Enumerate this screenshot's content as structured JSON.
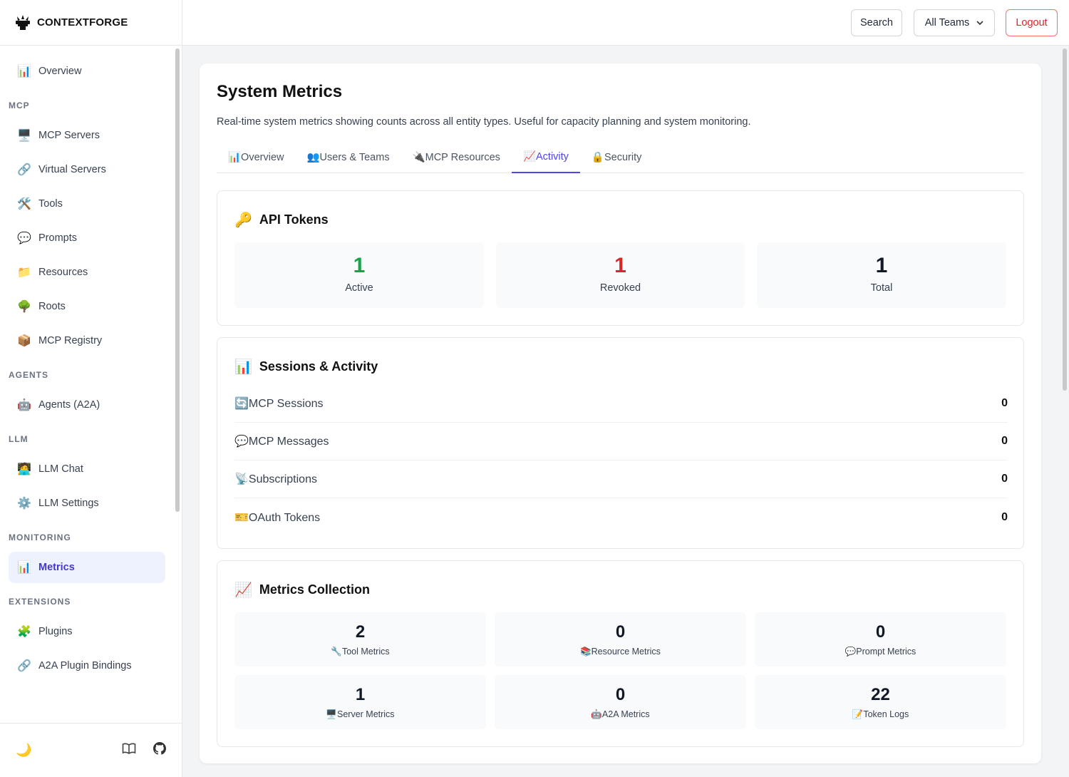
{
  "brand": {
    "name": "CONTEXTFORGE"
  },
  "sidebar": {
    "overview": {
      "label": "Overview",
      "icon": "📊"
    },
    "sections": [
      {
        "title": "MCP",
        "items": [
          {
            "label": "MCP Servers",
            "icon": "🖥️"
          },
          {
            "label": "Virtual Servers",
            "icon": "🔗"
          },
          {
            "label": "Tools",
            "icon": "🛠️"
          },
          {
            "label": "Prompts",
            "icon": "💬"
          },
          {
            "label": "Resources",
            "icon": "📁"
          },
          {
            "label": "Roots",
            "icon": "🌳"
          },
          {
            "label": "MCP Registry",
            "icon": "📦"
          }
        ]
      },
      {
        "title": "AGENTS",
        "items": [
          {
            "label": "Agents (A2A)",
            "icon": "🤖"
          }
        ]
      },
      {
        "title": "LLM",
        "items": [
          {
            "label": "LLM Chat",
            "icon": "🧑‍💻"
          },
          {
            "label": "LLM Settings",
            "icon": "⚙️"
          }
        ]
      },
      {
        "title": "MONITORING",
        "items": [
          {
            "label": "Metrics",
            "icon": "📊",
            "active": true
          }
        ]
      },
      {
        "title": "EXTENSIONS",
        "items": [
          {
            "label": "Plugins",
            "icon": "🧩"
          },
          {
            "label": "A2A Plugin Bindings",
            "icon": "🔗"
          }
        ]
      }
    ],
    "footer": {
      "theme_icon": "🌙"
    }
  },
  "topbar": {
    "search_label": "Search",
    "teams_label": "All Teams",
    "logout_label": "Logout"
  },
  "main": {
    "title": "System Metrics",
    "subtitle": "Real-time system metrics showing counts across all entity types. Useful for capacity planning and system monitoring.",
    "tabs": [
      {
        "label": "📊Overview"
      },
      {
        "label": "👥Users & Teams"
      },
      {
        "label": "🔌MCP Resources"
      },
      {
        "label": "📈Activity",
        "active": true
      },
      {
        "label": "🔒Security"
      }
    ],
    "api_tokens": {
      "title": "API Tokens",
      "icon": "🔑",
      "stats": [
        {
          "value": "1",
          "label": "Active",
          "color": "#16a34a"
        },
        {
          "value": "1",
          "label": "Revoked",
          "color": "#dc2626"
        },
        {
          "value": "1",
          "label": "Total",
          "color": "#111827"
        }
      ]
    },
    "sessions": {
      "title": "Sessions & Activity",
      "icon": "📊",
      "rows": [
        {
          "label": "🔄MCP Sessions",
          "value": "0"
        },
        {
          "label": "💬MCP Messages",
          "value": "0"
        },
        {
          "label": "📡Subscriptions",
          "value": "0"
        },
        {
          "label": "🎫OAuth Tokens",
          "value": "0"
        }
      ]
    },
    "metrics_collection": {
      "title": "Metrics Collection",
      "icon": "📈",
      "stats": [
        {
          "value": "2",
          "label": "🔧Tool Metrics"
        },
        {
          "value": "0",
          "label": "📚Resource Metrics"
        },
        {
          "value": "0",
          "label": "💬Prompt Metrics"
        },
        {
          "value": "1",
          "label": "🖥️Server Metrics"
        },
        {
          "value": "0",
          "label": "🤖A2A Metrics"
        },
        {
          "value": "22",
          "label": "📝Token Logs"
        }
      ]
    }
  }
}
